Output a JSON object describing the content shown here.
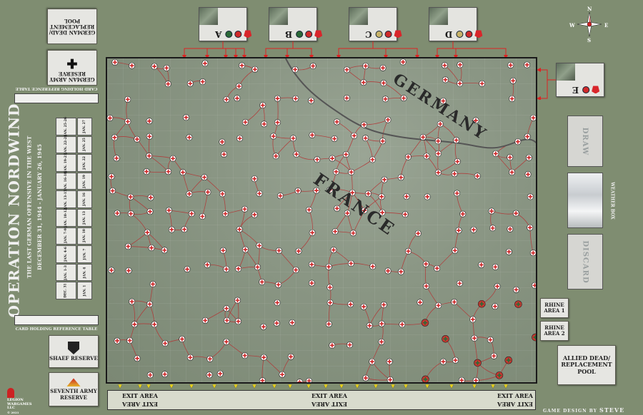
{
  "game_title": "OPERATION NORDWIND",
  "subtitle_1": "THE LAST GERMAN OFFENSIVE IN THE WEST",
  "subtitle_2": "DECEMBER 31, 1944 - JANUARY 26, 1945",
  "card_table_label_top": "CARD HOLDING REFERENCE TABLE",
  "card_table_label_bottom": "CARD HOLDING REFERENCE TABLE",
  "german_pool": "GERMAN DEAD/ REPLACEMENT POOL",
  "german_reserve": "GERMAN ARMY RESERVE",
  "armies": [
    {
      "letter": "A",
      "markers": [
        "flag",
        "red",
        "green"
      ]
    },
    {
      "letter": "B",
      "markers": [
        "flag",
        "red",
        "green"
      ]
    },
    {
      "letter": "C",
      "markers": [
        "flag",
        "red",
        "tan"
      ]
    },
    {
      "letter": "D",
      "markers": [
        "flag",
        "red",
        "tan"
      ]
    },
    {
      "letter": "E",
      "markers": [
        "flag",
        "red"
      ]
    }
  ],
  "countries": {
    "germany": "GERMANY",
    "france": "FRANCE"
  },
  "draw": "DRAW",
  "discard": "DISCARD",
  "weather_box": "WEATHER BOX",
  "rhine_1": "RHINE AREA 1",
  "rhine_2": "RHINE AREA 2",
  "allied_pool": "ALLIED DEAD/ REPLACEMENT POOL",
  "shaef_reserve": "SHAEF RESERVE",
  "seventh_army_reserve": "SEVENTH ARMY RESERVE",
  "exit_area": "EXIT AREA",
  "designer_label": "GAME DESIGN BY",
  "designer_name": "STEVE DIXON",
  "publisher": "LEGION WARGAMES LLC",
  "copyright": "© 2021",
  "compass": {
    "n": "N",
    "s": "S",
    "e": "E",
    "w": "W"
  },
  "turn_track": [
    "JAN. 25-26",
    "JAN. 27",
    "JAN. 22-24",
    "JAN. 25",
    "JAN. 19-21",
    "JAN. 22",
    "JAN. 16-18",
    "JAN. 19",
    "JAN. 13-15",
    "JAN. 16",
    "JAN. 10-12",
    "JAN. 13",
    "JAN. 7-9",
    "JAN. 10",
    "JAN. 4-6",
    "JAN. 7",
    "JAN. 1-3",
    "JAN. 4",
    "DEC. 31",
    "JAN. 1"
  ],
  "colors": {
    "board": "#7f8d71",
    "german_flag": "#d8262b",
    "german_space": "#c8362f",
    "allied_space": "#ffffff",
    "road": "#b43232",
    "arrow": "#d22222",
    "exit_marker": "#e6d21a"
  }
}
